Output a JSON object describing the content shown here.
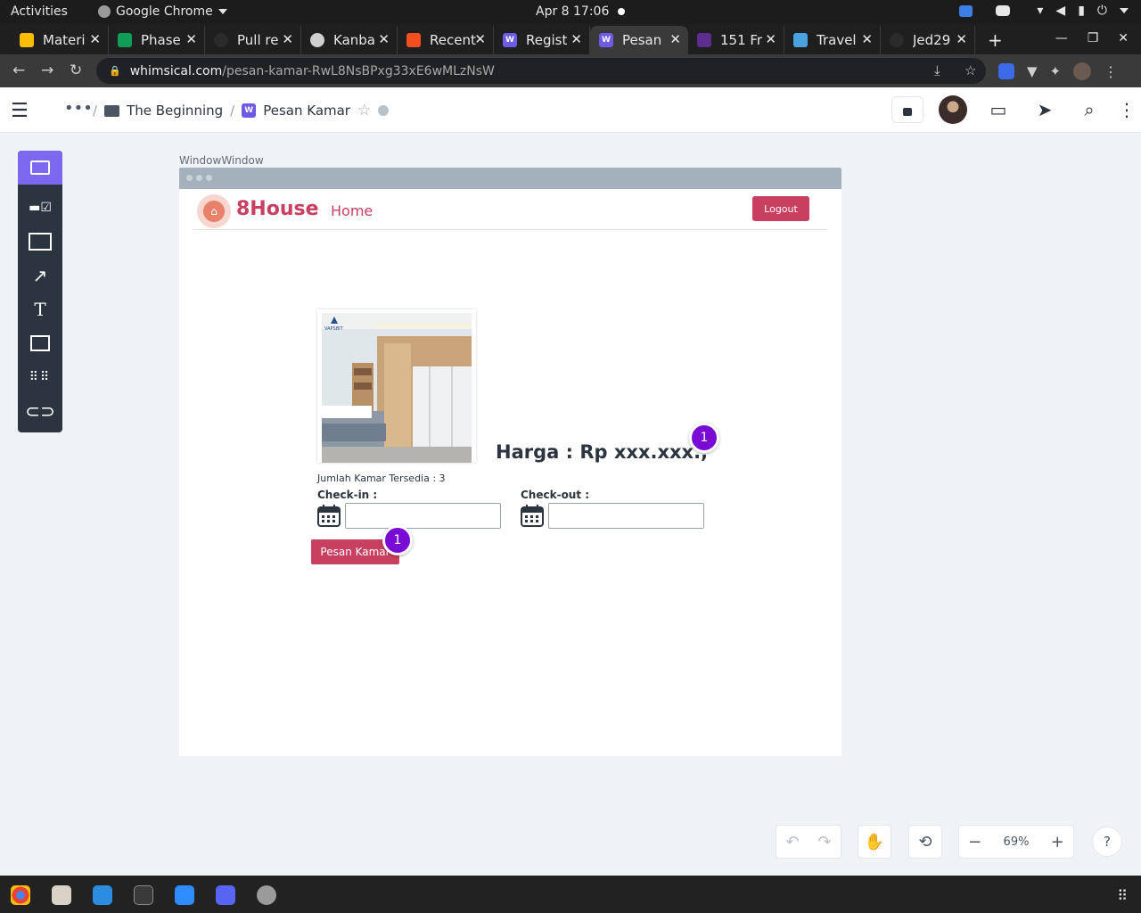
{
  "system": {
    "activities": "Activities",
    "app_name": "Google Chrome",
    "clock": "Apr 8  17:06"
  },
  "browser": {
    "tabs": [
      {
        "label": "Materi",
        "color": "#fbbc04"
      },
      {
        "label": "Phase",
        "color": "#0f9d58"
      },
      {
        "label": "Pull re",
        "color": "#2b2b2b"
      },
      {
        "label": "Kanba",
        "color": "#cfcfcf"
      },
      {
        "label": "Recent",
        "color": "#f24e1e"
      },
      {
        "label": "Regist",
        "color": "#6d5ae6"
      },
      {
        "label": "Pesan",
        "color": "#6d5ae6"
      },
      {
        "label": "151 Fr",
        "color": "#5b2d8e"
      },
      {
        "label": "Travel",
        "color": "#4aa3df"
      },
      {
        "label": "Jed29",
        "color": "#2b2b2b"
      }
    ],
    "active_tab": 6,
    "url_host": "whimsical.com",
    "url_path": "/pesan-kamar-RwL8NsBPxg33xE6wMLzNsW"
  },
  "app": {
    "breadcrumb": {
      "folder": "The Beginning",
      "board": "Pesan Kamar",
      "separator": "/"
    },
    "frame_label": "WindowWindow",
    "zoom": "69%",
    "help": "?"
  },
  "mock": {
    "brand": "8House",
    "nav_home": "Home",
    "logout": "Logout",
    "available": "Jumlah Kamar Tersedia : 3",
    "price": "Harga : Rp xxx.xxx.,",
    "checkin_label": "Check-in :",
    "checkout_label": "Check-out :",
    "checkin_value": "",
    "checkout_value": "",
    "order_button": "Pesan Kamar",
    "badge_count_1": "1",
    "badge_count_2": "1",
    "image_watermark": "VAPSBIT"
  },
  "colors": {
    "brand": "#c93f60",
    "badge": "#7a0bd4",
    "tool_selected": "#7b68ee",
    "toolbar": "#2c3440"
  }
}
